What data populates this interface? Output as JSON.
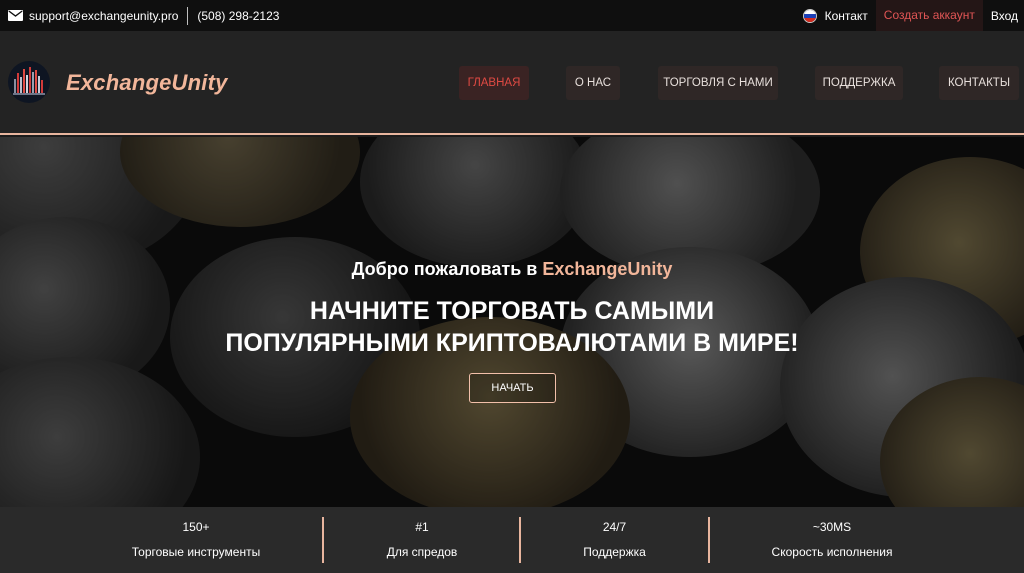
{
  "topbar": {
    "email": "support@exchangeunity.pro",
    "phone": "(508) 298-2123",
    "contact_label": "Контакт",
    "create_account_label": "Создать аккаунт",
    "login_label": "Вход",
    "mail_icon": "mail-icon",
    "flag_icon": "russia-flag-icon"
  },
  "header": {
    "logo_text": "ExchangeUnity",
    "nav": [
      {
        "label": "ГЛАВНАЯ",
        "active": true
      },
      {
        "label": "О НАС",
        "active": false
      },
      {
        "label": "ТОРГОВЛЯ С НАМИ",
        "active": false
      },
      {
        "label": "ПОДДЕРЖКА",
        "active": false
      },
      {
        "label": "КОНТАКТЫ",
        "active": false
      }
    ]
  },
  "hero": {
    "welcome_prefix": "Добро пожаловать в ",
    "welcome_brand": "ExchangeUnity",
    "headline_line1": "НАЧНИТЕ ТОРГОВАТЬ САМЫМИ",
    "headline_line2": "ПОПУЛЯРНЫМИ КРИПТОВАЛЮТАМИ В МИРЕ!",
    "start_label": "НАЧАТЬ"
  },
  "stats": [
    {
      "value": "150+",
      "label": "Торговые инструменты"
    },
    {
      "value": "#1",
      "label": "Для спредов"
    },
    {
      "value": "24/7",
      "label": "Поддержка"
    },
    {
      "value": "~30MS",
      "label": "Скорость исполнения"
    }
  ],
  "colors": {
    "accent": "#f2b69a",
    "active_nav_text": "#e04a43",
    "create_account_text": "#e05555"
  }
}
